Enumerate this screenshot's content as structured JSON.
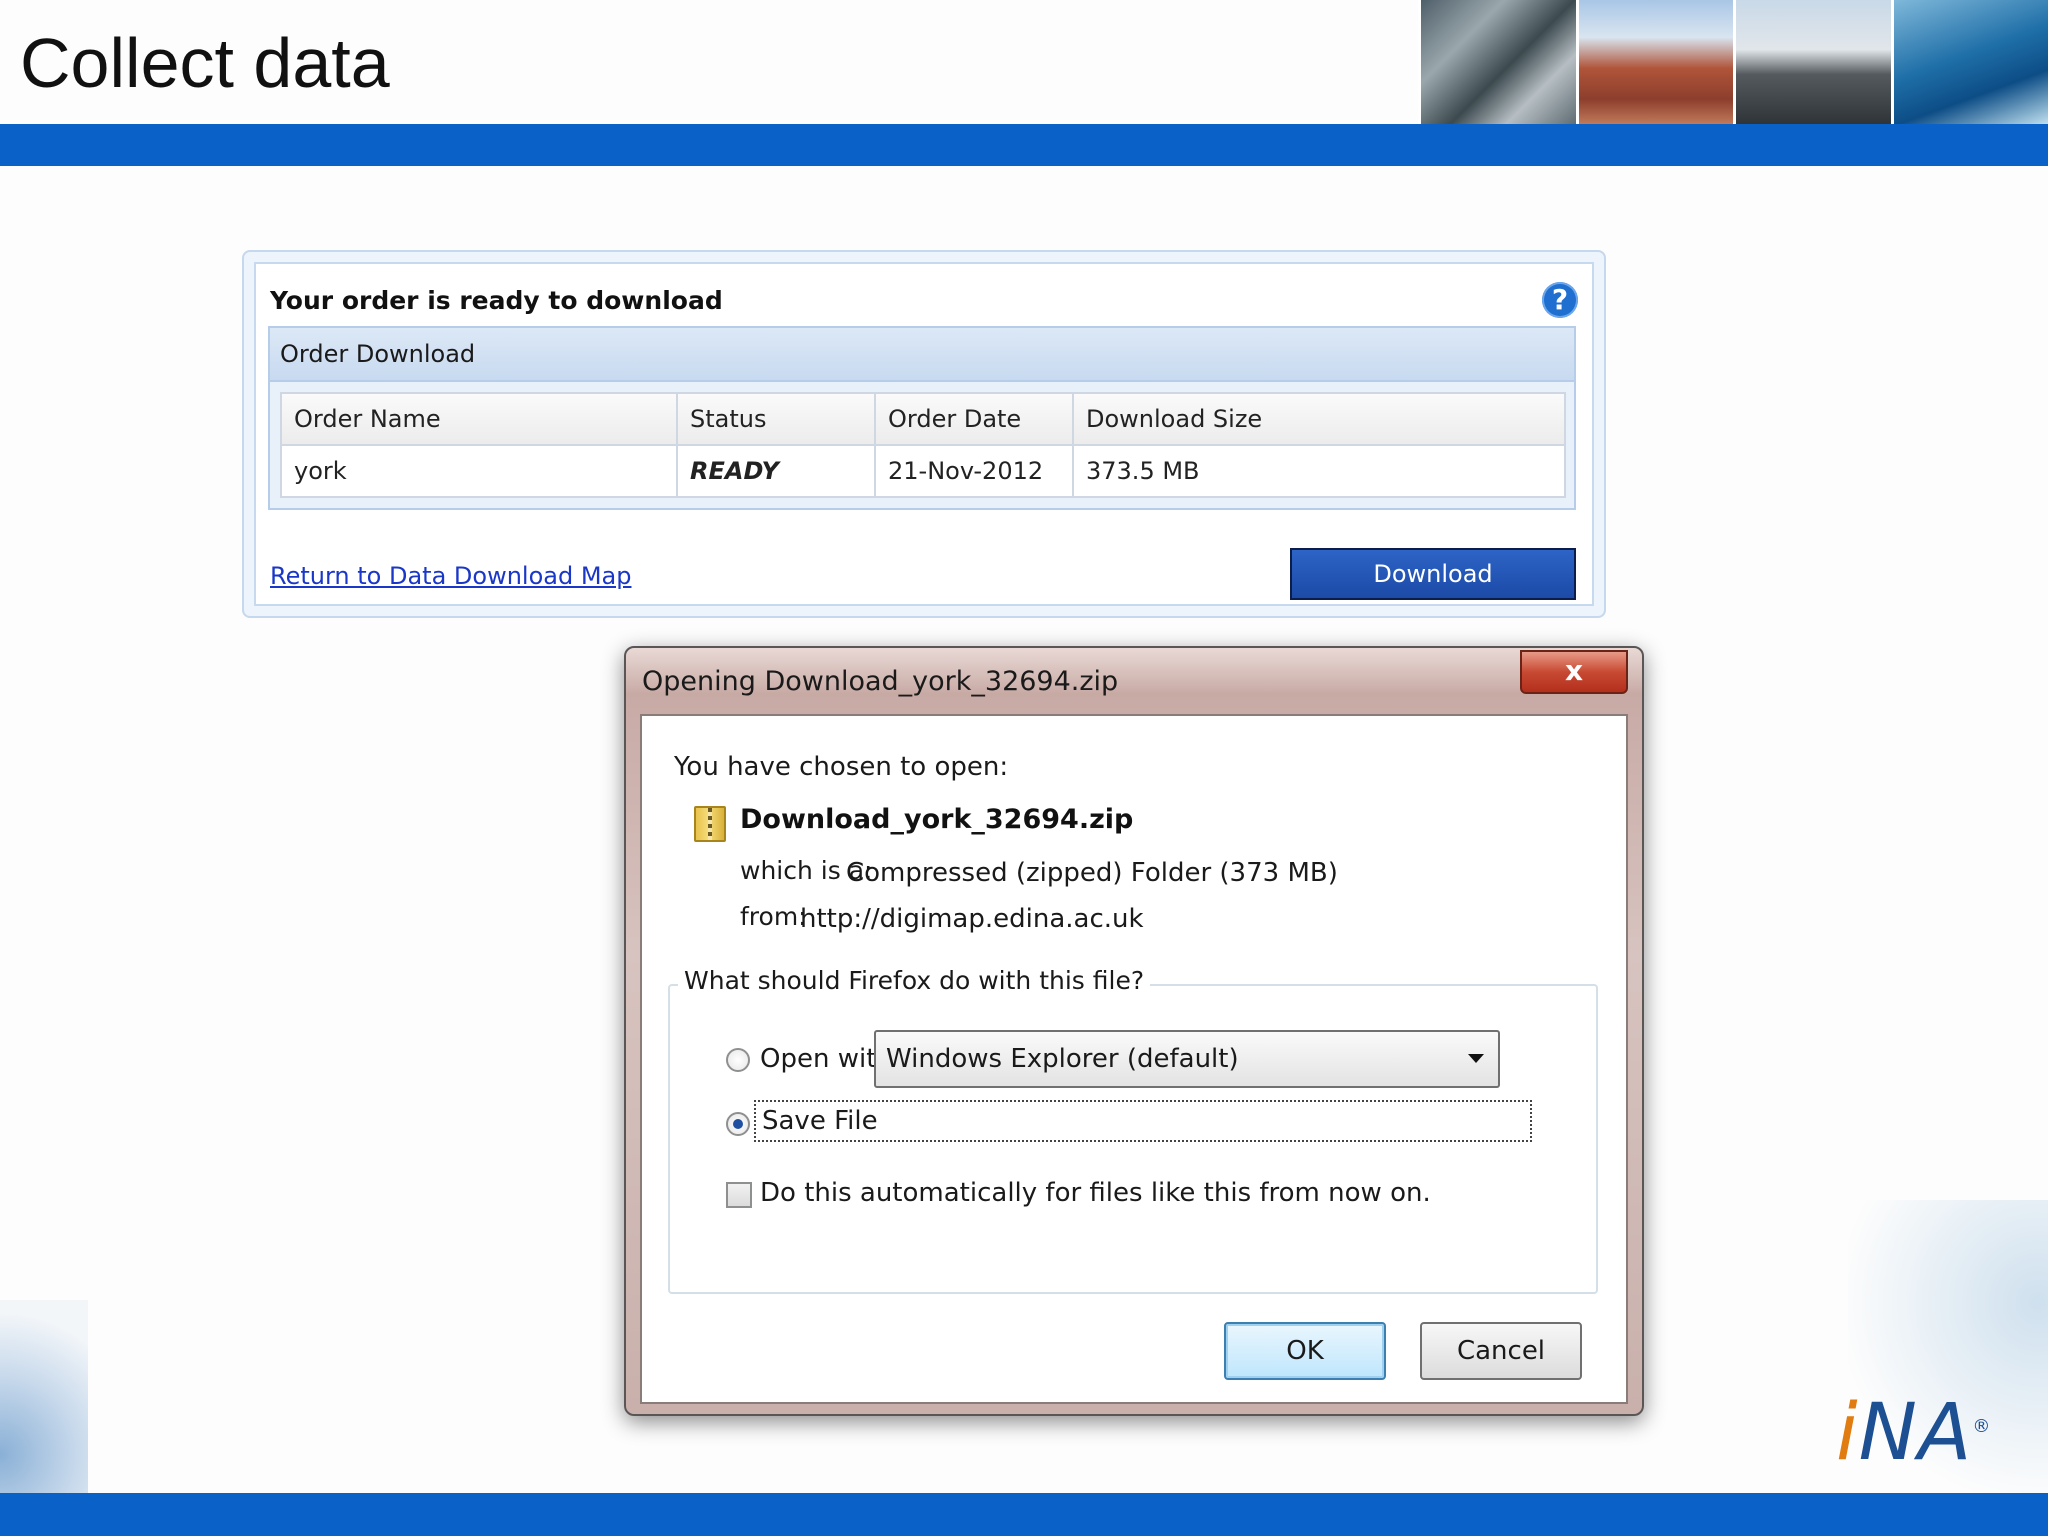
{
  "slide": {
    "title": "Collect data",
    "logo_text": "NA"
  },
  "order_panel": {
    "title": "Your order is ready to download",
    "section_header": "Order Download",
    "columns": [
      "Order Name",
      "Status",
      "Order Date",
      "Download Size"
    ],
    "rows": [
      [
        "york",
        "READY",
        "21-Nov-2012",
        "373.5 MB"
      ]
    ],
    "return_link": "Return to Data Download Map",
    "download_button": "Download",
    "help_icon": "?"
  },
  "dialog": {
    "title": "Opening Download_york_32694.zip",
    "close_label": "x",
    "chosen_text": "You have chosen to open:",
    "filename": "Download_york_32694.zip",
    "which_label": "which is a:",
    "which_value": "Compressed (zipped) Folder (373 MB)",
    "from_label": "from:",
    "from_value": "http://digimap.edina.ac.uk",
    "question": "What should Firefox do with this file?",
    "open_with_label": "Open with",
    "open_with_value": "Windows Explorer (default)",
    "save_file_label": "Save File",
    "selected_option": "Save File",
    "auto_label": "Do this automatically for files like this from now on.",
    "ok_button": "OK",
    "cancel_button": "Cancel"
  },
  "colors": {
    "band_blue": "#0a61c8",
    "link_blue": "#1a37c8",
    "button_blue": "#1c4aa7",
    "close_red": "#c84a33"
  },
  "icons": {
    "help": "help-icon",
    "zip": "zip-file-icon",
    "close": "close-icon",
    "dropdown": "chevron-down-icon"
  }
}
